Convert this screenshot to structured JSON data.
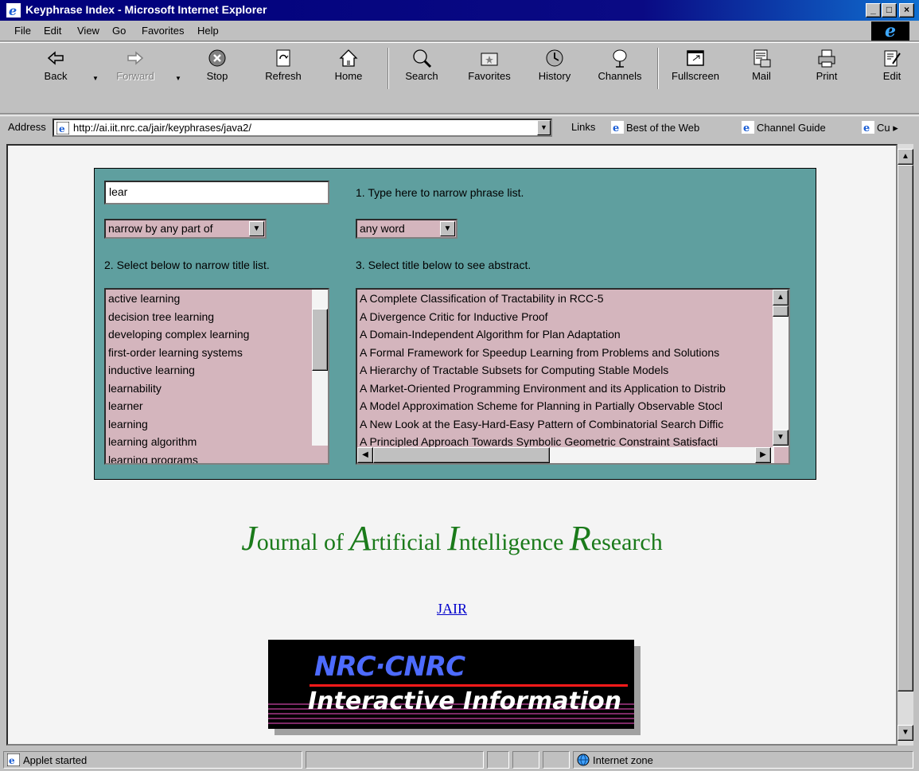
{
  "window": {
    "title": "Keyphrase Index - Microsoft Internet Explorer",
    "minimize": "_",
    "maximize": "□",
    "close": "×"
  },
  "menu": {
    "items": [
      {
        "label": "File"
      },
      {
        "label": "Edit"
      },
      {
        "label": "View"
      },
      {
        "label": "Go"
      },
      {
        "label": "Favorites"
      },
      {
        "label": "Help"
      }
    ]
  },
  "toolbar": {
    "back": "Back",
    "forward": "Forward",
    "stop": "Stop",
    "refresh": "Refresh",
    "home": "Home",
    "search": "Search",
    "favorites": "Favorites",
    "history": "History",
    "channels": "Channels",
    "fullscreen": "Fullscreen",
    "mail": "Mail",
    "print": "Print",
    "edit": "Edit"
  },
  "address": {
    "label": "Address",
    "url": "http://ai.iit.nrc.ca/jair/keyphrases/java2/",
    "links_label": "Links",
    "links": [
      "Best of the Web",
      "Channel Guide",
      "Cu"
    ]
  },
  "applet": {
    "search_value": "lear",
    "hint1": "1. Type here to narrow phrase list.",
    "narrow_mode": "narrow by any part of",
    "word_mode": "any word",
    "hint2": "2. Select below to narrow title list.",
    "hint3": "3. Select title below to see abstract.",
    "phrases": [
      "active learning",
      "decision tree learning",
      "developing complex learning",
      "first-order learning systems",
      "inductive learning",
      "learnability",
      "learner",
      "learning",
      "learning algorithm",
      "learning programs"
    ],
    "titles": [
      "A Complete Classification of Tractability in RCC-5",
      "A Divergence Critic for Inductive Proof",
      "A Domain-Independent Algorithm for Plan Adaptation",
      "A Formal Framework for Speedup Learning from Problems and Solutions",
      "A Hierarchy of Tractable Subsets for Computing Stable Models",
      "A Market-Oriented Programming Environment and its Application to Distrib",
      "A Model Approximation Scheme for Planning in Partially Observable Stocl",
      "A New Look at the Easy-Hard-Easy Pattern of Combinatorial Search Diffic",
      "A Principled Approach Towards Symbolic Geometric Constraint Satisfacti"
    ]
  },
  "page": {
    "journal": [
      {
        "cap": "J",
        "rest": "ournal of "
      },
      {
        "cap": "A",
        "rest": "rtificial "
      },
      {
        "cap": "I",
        "rest": "ntelligence "
      },
      {
        "cap": "R",
        "rest": "esearch"
      }
    ],
    "jair_link": "JAIR",
    "banner_logo": "NRC·CNRC",
    "banner_tagline": "Interactive Information"
  },
  "status": {
    "text": "Applet started",
    "zone": "Internet zone"
  },
  "colors": {
    "applet_bg": "#5f9f9f",
    "list_bg": "#d4b5bd",
    "journal_green": "#1a7a1a",
    "link_blue": "#0000cc"
  }
}
